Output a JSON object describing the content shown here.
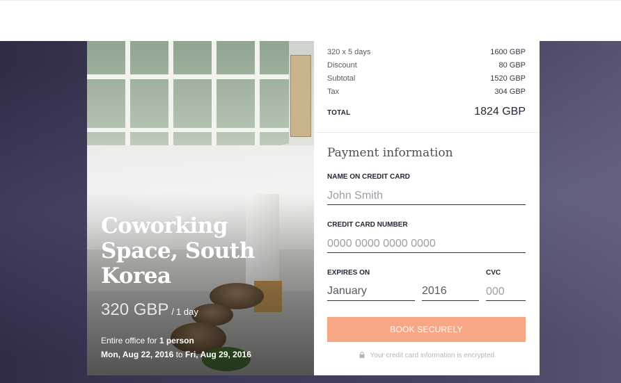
{
  "listing": {
    "title": "Coworking Space, South Korea",
    "price": "320 GBP",
    "price_separator": "/",
    "price_unit": "1 day",
    "detail_prefix": "Entire office for",
    "detail_people": "1 person",
    "start_date": "Mon, Aug 22, 2016",
    "date_connector": "to",
    "end_date": "Fri, Aug 29, 2016"
  },
  "summary": {
    "rows": [
      {
        "label": "320 x 5 days",
        "value": "1600 GBP"
      },
      {
        "label": "Discount",
        "value": "80 GBP"
      },
      {
        "label": "Subtotal",
        "value": "1520 GBP"
      },
      {
        "label": "Tax",
        "value": "304 GBP"
      }
    ],
    "total_label": "TOTAL",
    "total_value": "1824 GBP"
  },
  "payment": {
    "heading": "Payment information",
    "name_label": "NAME ON CREDIT CARD",
    "name_placeholder": "John Smith",
    "card_label": "CREDIT CARD NUMBER",
    "card_placeholder": "0000 0000 0000 0000",
    "expires_label": "EXPIRES ON",
    "expires_month": "January",
    "expires_year": "2016",
    "cvc_label": "CVC",
    "cvc_placeholder": "000",
    "button_label": "BOOK SECURELY",
    "secure_note": "Your credit card information is encrypted"
  },
  "colors": {
    "button": "#f7a686",
    "backdrop": "#3b3955",
    "text_dark": "#222833"
  },
  "icons": {
    "secure": "lock-icon"
  }
}
